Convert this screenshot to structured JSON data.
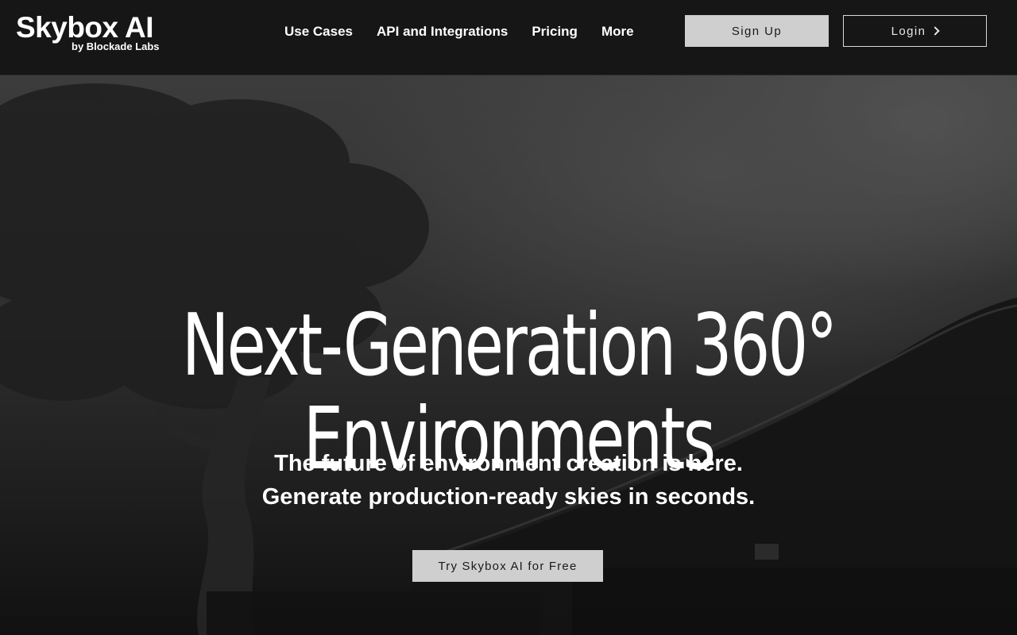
{
  "brand": {
    "name": "Skybox AI",
    "byline": "by Blockade Labs"
  },
  "nav": {
    "items": [
      {
        "label": "Use Cases"
      },
      {
        "label": "API and Integrations"
      },
      {
        "label": "Pricing"
      },
      {
        "label": "More"
      }
    ]
  },
  "auth": {
    "signup_label": "Sign Up",
    "login_label": "Login",
    "login_icon": "chevron-right-icon"
  },
  "hero": {
    "title_line1": "Next-Generation 360°",
    "title_line2": "Environments",
    "subtitle_line1": "The future of environment creation is here.",
    "subtitle_line2": "Generate production-ready skies in seconds.",
    "cta_label": "Try Skybox AI for Free"
  },
  "colors": {
    "header_bg": "#161616",
    "button_fill": "#cfcfcf",
    "text": "#ffffff"
  }
}
